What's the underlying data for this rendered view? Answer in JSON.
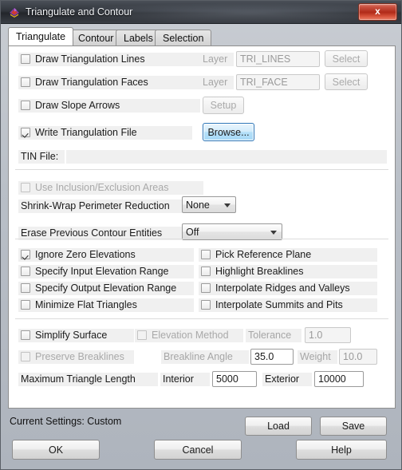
{
  "window": {
    "title": "Triangulate and Contour",
    "icon": "app-icon",
    "close_label": "x"
  },
  "tabs": [
    {
      "label": "Triangulate",
      "active": true
    },
    {
      "label": "Contour",
      "active": false
    },
    {
      "label": "Labels",
      "active": false
    },
    {
      "label": "Selection",
      "active": false
    }
  ],
  "form": {
    "draw_lines": {
      "label": "Draw Triangulation Lines",
      "checked": false,
      "layer_label": "Layer",
      "layer_value": "TRI_LINES",
      "select_label": "Select"
    },
    "draw_faces": {
      "label": "Draw Triangulation Faces",
      "checked": false,
      "layer_label": "Layer",
      "layer_value": "TRI_FACE",
      "select_label": "Select"
    },
    "draw_slope_arrows": {
      "label": "Draw Slope Arrows",
      "checked": false,
      "setup_label": "Setup"
    },
    "write_tri_file": {
      "label": "Write Triangulation File",
      "checked": true,
      "browse_label": "Browse..."
    },
    "tin_file": {
      "label": "TIN File:",
      "value": ""
    },
    "use_inclusion": {
      "label": "Use Inclusion/Exclusion Areas",
      "checked": false
    },
    "shrink_wrap": {
      "label": "Shrink-Wrap Perimeter Reduction",
      "value": "None"
    },
    "erase_previous": {
      "label": "Erase Previous Contour Entities",
      "value": "Off"
    },
    "options_left": [
      {
        "label": "Ignore Zero Elevations",
        "checked": true
      },
      {
        "label": "Specify Input Elevation Range",
        "checked": false
      },
      {
        "label": "Specify Output Elevation Range",
        "checked": false
      },
      {
        "label": "Minimize Flat Triangles",
        "checked": false
      }
    ],
    "options_right": [
      {
        "label": "Pick Reference Plane",
        "checked": false
      },
      {
        "label": "Highlight Breaklines",
        "checked": false
      },
      {
        "label": "Interpolate Ridges and Valleys",
        "checked": false
      },
      {
        "label": "Interpolate Summits and Pits",
        "checked": false
      }
    ],
    "simplify": {
      "label": "Simplify Surface",
      "checked": false,
      "elevation_method_label": "Elevation Method",
      "elevation_method_checked": false,
      "tolerance_label": "Tolerance",
      "tolerance_value": "1.0"
    },
    "preserve": {
      "label": "Preserve Breaklines",
      "checked": false,
      "angle_label": "Breakline Angle",
      "angle_value": "35.0",
      "weight_label": "Weight",
      "weight_value": "10.0"
    },
    "max_triangle": {
      "label": "Maximum Triangle Length",
      "interior_label": "Interior",
      "interior_value": "5000",
      "exterior_label": "Exterior",
      "exterior_value": "10000"
    }
  },
  "footer": {
    "status": "Current Settings: Custom",
    "load_label": "Load",
    "save_label": "Save",
    "ok_label": "OK",
    "cancel_label": "Cancel",
    "help_label": "Help"
  }
}
